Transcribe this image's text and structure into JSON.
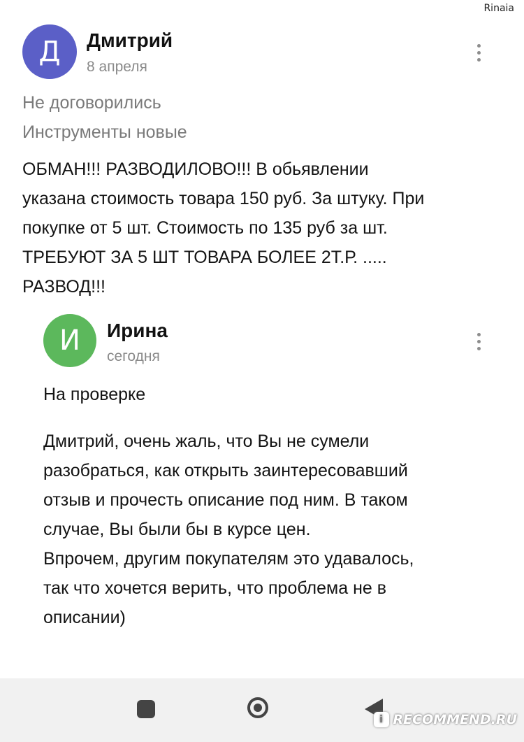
{
  "watermark_top": "Rinaia",
  "review": {
    "avatar_letter": "Д",
    "author": "Дмитрий",
    "date": "8 апреля",
    "status": "Не договорились",
    "tag": "Инструменты новые",
    "text": "ОБМАН!!!  РАЗВОДИЛОВО!!!  В обьявлении\nуказана стоимость товара 150 руб. За штуку. При\nпокупке от 5 шт. Стоимость по 135 руб за шт.\nТРЕБУЮТ ЗА 5 ШТ ТОВАРА БОЛЕЕ 2Т.Р. .....\nРАЗВОД!!!",
    "menu_icon": "more-vert-icon"
  },
  "reply": {
    "avatar_letter": "И",
    "author": "Ирина",
    "date": "сегодня",
    "status": "На проверке",
    "text": "Дмитрий, очень жаль, что Вы не сумели\nразобраться, как открыть заинтересовавший\nотзыв и прочесть описание под ним. В таком\nслучае, Вы были бы в курсе цен.\nВпрочем, другим покупателям это удавалось,\nтак что хочется верить, что проблема не в\nописании)",
    "menu_icon": "more-vert-icon"
  },
  "navbar": {
    "recents_icon": "square-icon",
    "home_icon": "circle-icon",
    "back_icon": "triangle-back-icon"
  },
  "brand_watermark": "RECOMMEND.RU",
  "colors": {
    "avatar_main": "#5b5fc7",
    "avatar_reply": "#5cb85c",
    "secondary_text": "#8a8a8a"
  }
}
